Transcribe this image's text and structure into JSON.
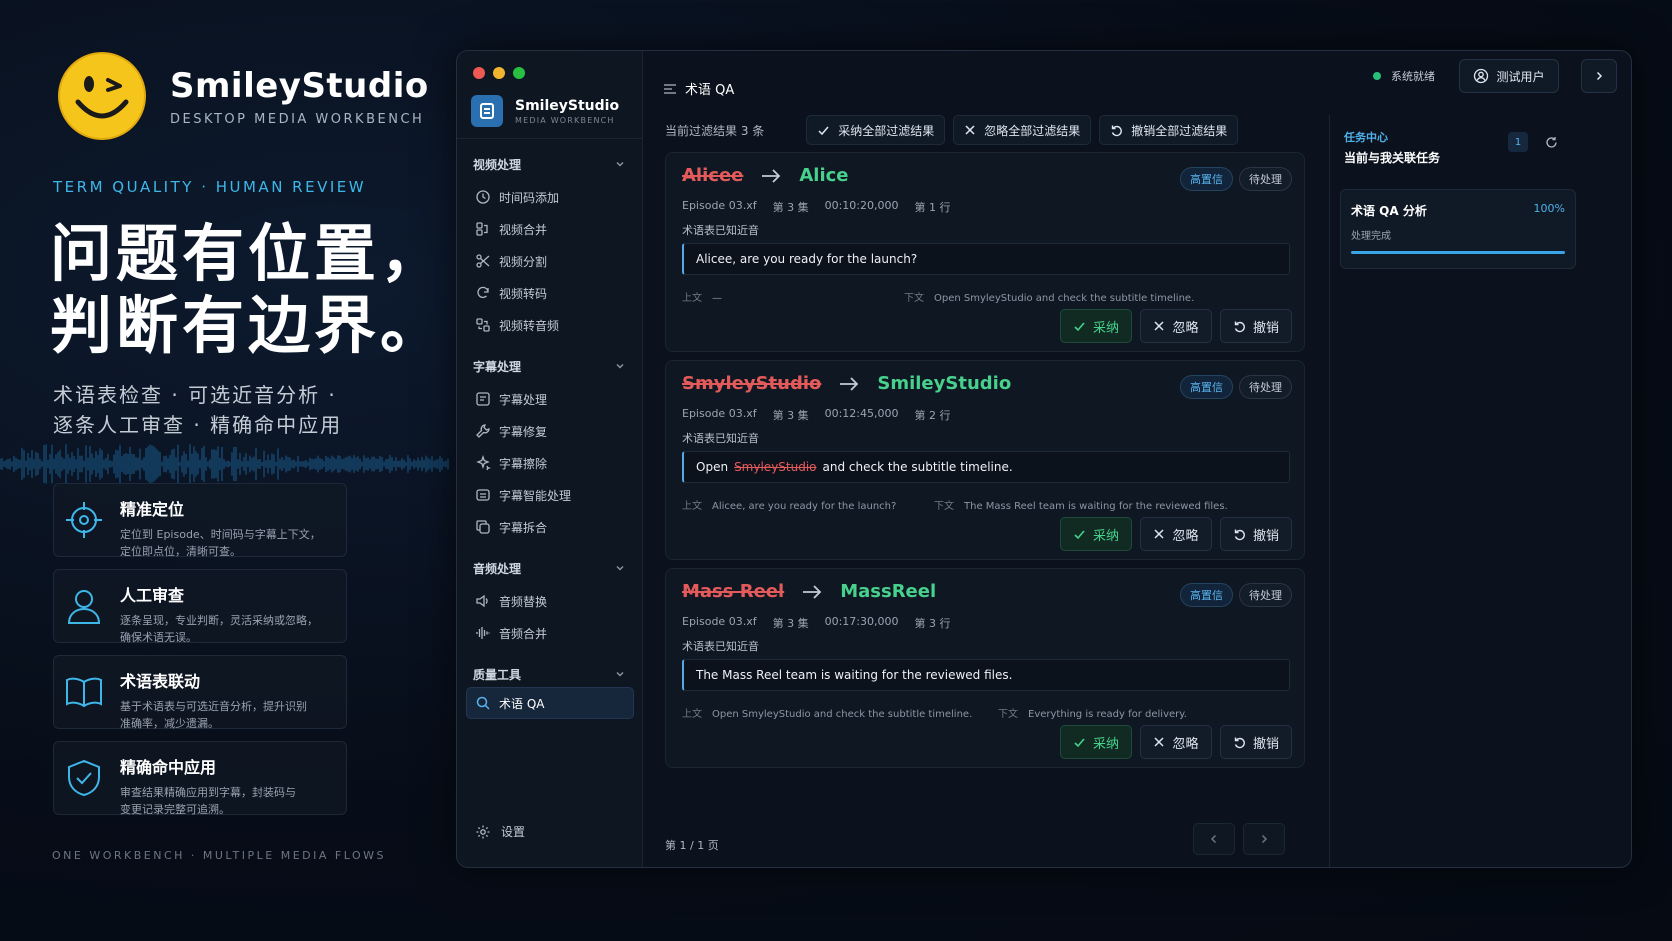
{
  "brand": {
    "name": "SmileyStudio",
    "subtitle": "DESKTOP MEDIA WORKBENCH"
  },
  "tagline": "TERM QUALITY · HUMAN REVIEW",
  "headline": {
    "line1": "问题有位置，",
    "line2": "判断有边界。"
  },
  "subline": {
    "line1": "术语表检查 · 可选近音分析 ·",
    "line2": "逐条人工审查 · 精确命中应用"
  },
  "features": [
    {
      "icon": "target-icon",
      "title": "精准定位",
      "desc1": "定位到 Episode、时间码与字幕上下文，",
      "desc2": "定位即点位，清晰可查。"
    },
    {
      "icon": "user-icon",
      "title": "人工审查",
      "desc1": "逐条呈现，专业判断，灵活采纳或忽略，",
      "desc2": "确保术语无误。"
    },
    {
      "icon": "book-icon",
      "title": "术语表联动",
      "desc1": "基于术语表与可选近音分析，提升识别",
      "desc2": "准确率，减少遗漏。"
    },
    {
      "icon": "shield-check-icon",
      "title": "精确命中应用",
      "desc1": "审查结果精确应用到字幕，封装码与",
      "desc2": "变更记录完整可追溯。"
    }
  ],
  "footer_tag": "ONE WORKBENCH · MULTIPLE MEDIA FLOWS",
  "window": {
    "sidebar": {
      "brand_name": "SmileyStudio",
      "brand_sub": "MEDIA WORKBENCH",
      "groups": [
        {
          "label": "视频处理",
          "items": [
            "时间码添加",
            "视频合并",
            "视频分割",
            "视频转码",
            "视频转音频"
          ]
        },
        {
          "label": "字幕处理",
          "items": [
            "字幕处理",
            "字幕修复",
            "字幕擦除",
            "字幕智能处理",
            "字幕拆合"
          ]
        },
        {
          "label": "音频处理",
          "items": [
            "音频替换",
            "音频合并"
          ]
        },
        {
          "label": "质量工具",
          "items": [
            "术语 QA"
          ]
        }
      ],
      "settings": "设置"
    },
    "topbar": {
      "page_title": "术语 QA",
      "status": "系统就绪",
      "user": "测试用户"
    },
    "filterbar": {
      "count": "当前过滤结果 3 条",
      "accept_all": "采纳全部过滤结果",
      "ignore_all": "忽略全部过滤结果",
      "undo_all": "撤销全部过滤结果"
    },
    "cards": [
      {
        "wrong": "Alicee",
        "right": "Alice",
        "badge_conf": "高置信",
        "badge_state": "待处理",
        "episode": "Episode 03.xf",
        "ep_no": "第 3 集",
        "timecode": "00:10:20,000",
        "line": "第 1 行",
        "reason": "术语表已知近音",
        "sentence_before": "",
        "sentence_bad": "",
        "sentence_after": "Alicee, are you ready for the launch?",
        "prev_label": "上文",
        "prev": "—",
        "next_label": "下文",
        "next": "Open SmyleyStudio and check the subtitle timeline.",
        "accept": "采纳",
        "ignore": "忽略",
        "undo": "撤销"
      },
      {
        "wrong": "SmyleyStudio",
        "right": "SmileyStudio",
        "badge_conf": "高置信",
        "badge_state": "待处理",
        "episode": "Episode 03.xf",
        "ep_no": "第 3 集",
        "timecode": "00:12:45,000",
        "line": "第 2 行",
        "reason": "术语表已知近音",
        "sentence_before": "Open",
        "sentence_bad": "SmyleyStudio",
        "sentence_after": "and check the subtitle timeline.",
        "prev_label": "上文",
        "prev": "Alicee, are you ready for the launch?",
        "next_label": "下文",
        "next": "The Mass Reel team is waiting for the reviewed files.",
        "accept": "采纳",
        "ignore": "忽略",
        "undo": "撤销"
      },
      {
        "wrong": "Mass Reel",
        "right": "MassReel",
        "badge_conf": "高置信",
        "badge_state": "待处理",
        "episode": "Episode 03.xf",
        "ep_no": "第 3 集",
        "timecode": "00:17:30,000",
        "line": "第 3 行",
        "reason": "术语表已知近音",
        "sentence_before": "",
        "sentence_bad": "",
        "sentence_after": "The Mass Reel team is waiting for the reviewed files.",
        "prev_label": "上文",
        "prev": "Open SmyleyStudio and check the subtitle timeline.",
        "next_label": "下文",
        "next": "Everything is ready for delivery.",
        "accept": "采纳",
        "ignore": "忽略",
        "undo": "撤销"
      }
    ],
    "pager": "第 1 / 1 页",
    "task_center": {
      "title": "任务中心",
      "subtitle": "当前与我关联任务",
      "count": "1",
      "task_name": "术语 QA 分析",
      "task_pct": "100%",
      "task_progress": 1.0,
      "task_status": "处理完成"
    }
  },
  "colors": {
    "accent": "#3fb6e8",
    "wrong": "#e35a5a",
    "right": "#47d18c"
  }
}
